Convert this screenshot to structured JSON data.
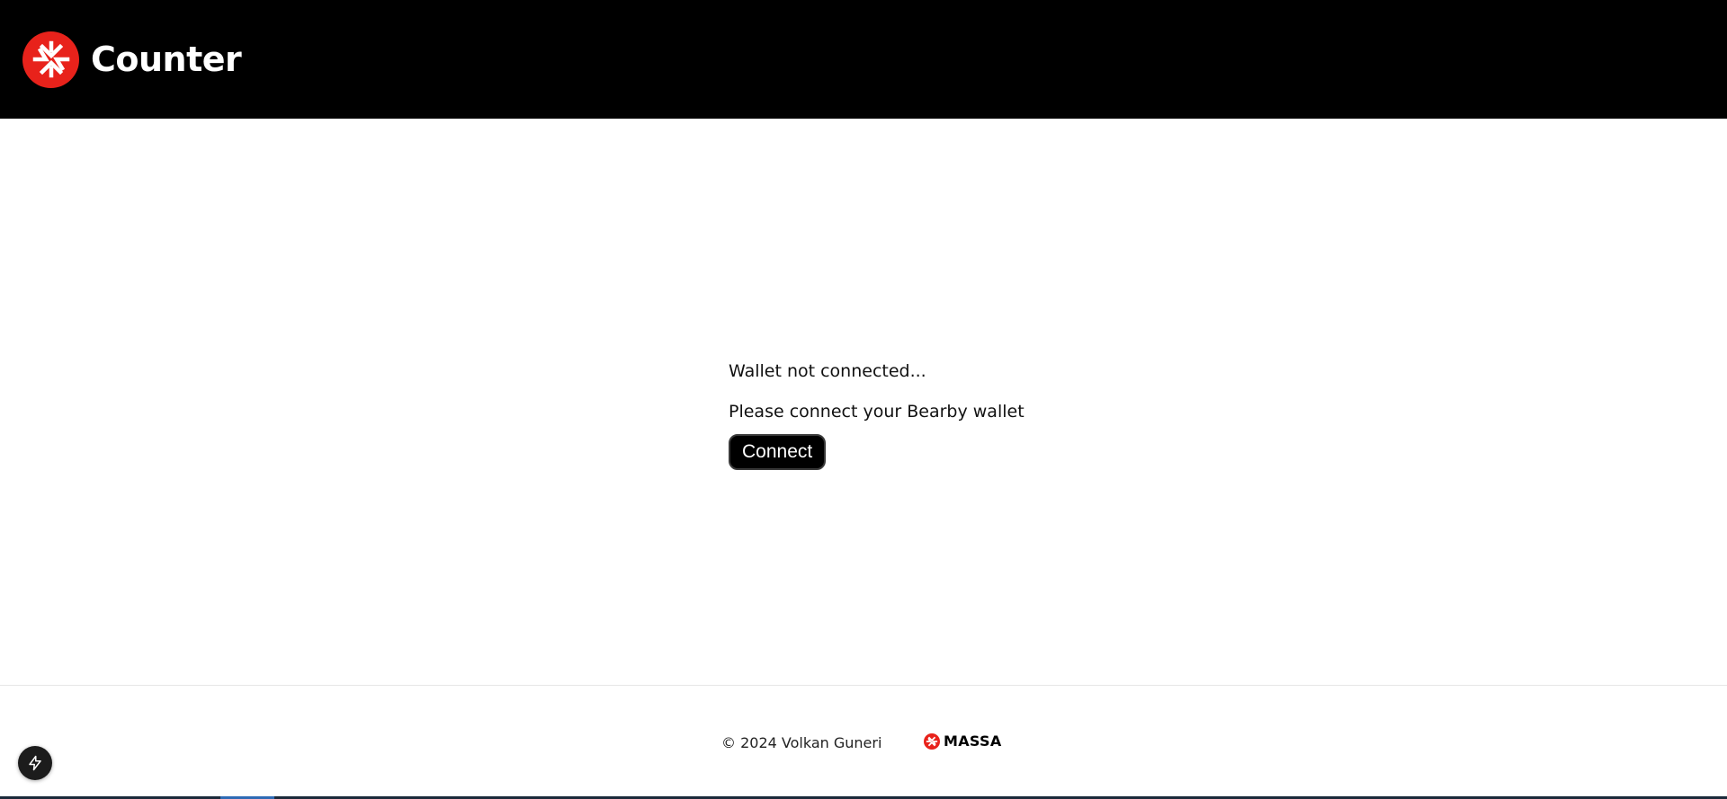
{
  "header": {
    "title": "Counter",
    "logo_icon": "massa-logo-icon",
    "background": "#000000",
    "logo_color": "#e8221b"
  },
  "main": {
    "status_message": "Wallet not connected...",
    "instruction": "Please connect your Bearby wallet",
    "connect_label": "Connect"
  },
  "footer": {
    "copyright": "© 2024 Volkan Guneri",
    "brand_label": "MASSA",
    "brand_icon": "massa-logo-icon"
  },
  "devtools": {
    "icon": "lightning-bolt-icon"
  }
}
